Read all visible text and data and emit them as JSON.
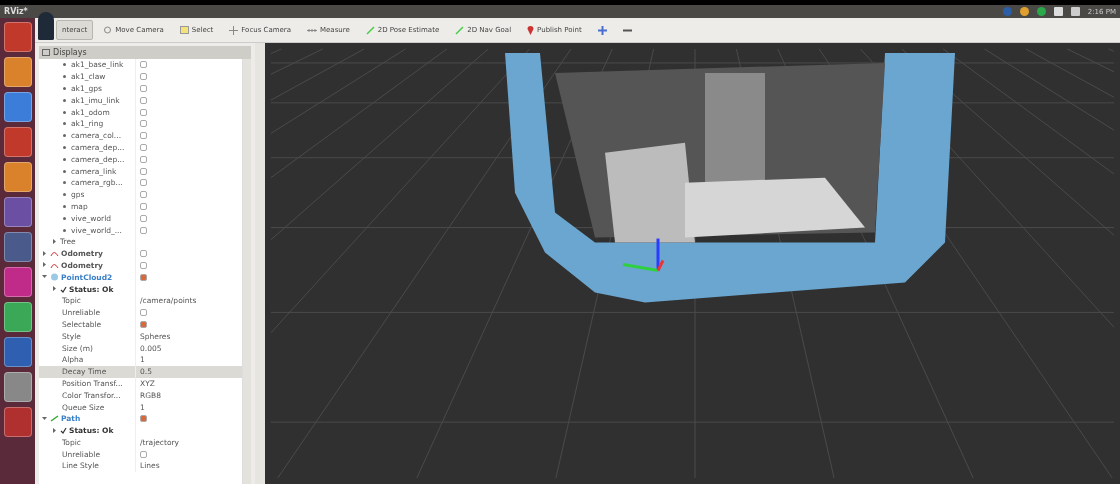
{
  "window": {
    "title": "RViz*"
  },
  "tray": {
    "time": "2:16 PM"
  },
  "toolbar": [
    {
      "label": "nteract",
      "selected": true
    },
    {
      "label": "Move Camera",
      "selected": false
    },
    {
      "label": "Select",
      "selected": false
    },
    {
      "label": "Focus Camera",
      "selected": false
    },
    {
      "label": "Measure",
      "selected": false
    },
    {
      "label": "2D Pose Estimate",
      "selected": false
    },
    {
      "label": "2D Nav Goal",
      "selected": false
    },
    {
      "label": "Publish Point",
      "selected": false
    },
    {
      "selected": false
    },
    {
      "selected": false
    }
  ],
  "displays": {
    "title": "Displays",
    "tree": [
      {
        "children": [
          {
            "children": [
              {
                "kind": "frame",
                "label": "ak1_base_link",
                "checked": false
              },
              {
                "kind": "frame",
                "label": "ak1_claw",
                "checked": false
              },
              {
                "kind": "frame",
                "label": "ak1_gps",
                "checked": false
              },
              {
                "kind": "frame",
                "label": "ak1_imu_link",
                "checked": false
              },
              {
                "kind": "frame",
                "label": "ak1_odom",
                "checked": false
              },
              {
                "kind": "frame",
                "label": "ak1_ring",
                "checked": false
              },
              {
                "kind": "frame",
                "label": "camera_col...",
                "checked": false
              },
              {
                "kind": "frame",
                "label": "camera_dep...",
                "checked": false
              },
              {
                "kind": "frame",
                "label": "camera_dep...",
                "checked": false
              },
              {
                "kind": "frame",
                "label": "camera_link",
                "checked": false
              },
              {
                "kind": "frame",
                "label": "camera_rgb...",
                "checked": false
              },
              {
                "kind": "frame",
                "label": "gps",
                "checked": false
              },
              {
                "kind": "frame",
                "label": "map",
                "checked": false
              },
              {
                "kind": "frame",
                "label": "vive_world",
                "checked": false
              },
              {
                "kind": "frame",
                "label": "vive_world_...",
                "checked": false
              }
            ]
          },
          {
            "kind": "group",
            "label": "Tree",
            "expanded": false
          }
        ]
      },
      {
        "kind": "display",
        "label": "Odometry",
        "checked": false,
        "expanded": false
      },
      {
        "kind": "display",
        "label": "Odometry",
        "checked": false,
        "expanded": false
      },
      {
        "kind": "display",
        "label": "PointCloud2",
        "checked": true,
        "expanded": true,
        "children": [
          {
            "kind": "status",
            "label": "Status: Ok",
            "expanded": false
          },
          {
            "kind": "text",
            "label": "Topic",
            "value": "/camera/points",
            "selected": false
          },
          {
            "kind": "check",
            "label": "Unreliable",
            "checked": false,
            "selected": false
          },
          {
            "kind": "check",
            "label": "Selectable",
            "checked": true,
            "selected": false
          },
          {
            "kind": "text",
            "label": "Style",
            "value": "Spheres",
            "selected": false
          },
          {
            "kind": "text",
            "label": "Size (m)",
            "value": "0.005",
            "selected": false
          },
          {
            "kind": "text",
            "label": "Alpha",
            "value": "1",
            "selected": false
          },
          {
            "kind": "text",
            "label": "Decay Time",
            "value": "0.5",
            "selected": true
          },
          {
            "kind": "text",
            "label": "Position Transf...",
            "value": "XYZ",
            "selected": false
          },
          {
            "kind": "text",
            "label": "Color Transfor...",
            "value": "RGB8",
            "selected": false
          },
          {
            "kind": "text",
            "label": "Queue Size",
            "value": "1",
            "selected": false
          }
        ]
      },
      {
        "kind": "display",
        "label": "Path",
        "checked": true,
        "expanded": true,
        "children": [
          {
            "kind": "status",
            "label": "Status: Ok",
            "expanded": false
          },
          {
            "kind": "text",
            "label": "Topic",
            "value": "/trajectory",
            "selected": false
          },
          {
            "kind": "check",
            "label": "Unreliable",
            "checked": false,
            "selected": false
          },
          {
            "kind": "text",
            "label": "Line Style",
            "value": "Lines",
            "selected": false
          }
        ]
      }
    ]
  }
}
